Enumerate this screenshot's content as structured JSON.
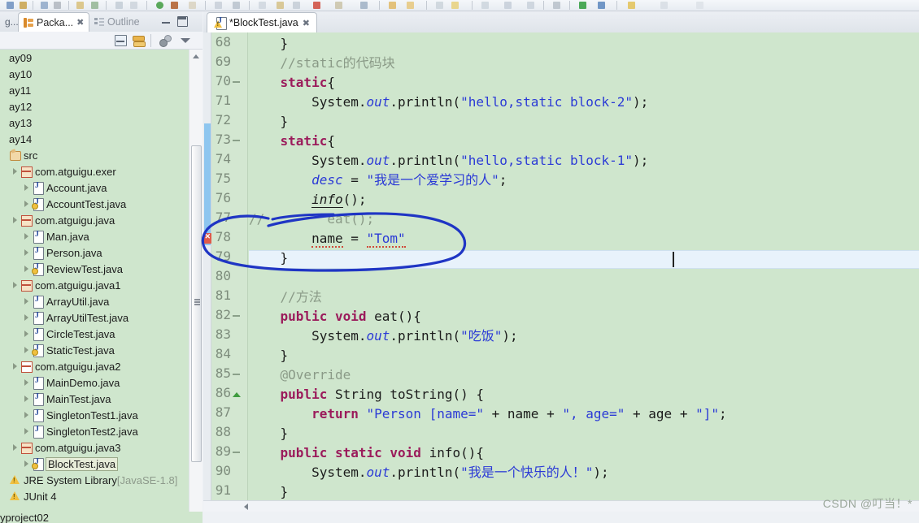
{
  "toolbar": {
    "name": "eclipse-toolbar"
  },
  "left_panel": {
    "tabs": {
      "partial_label": "g...",
      "active_label": "Packa...",
      "inactive_label": "Outline",
      "close_glyph": "✖"
    },
    "view_buttons": {
      "minimize": "minimize",
      "maximize": "maximize",
      "collapse_all": "collapse-all",
      "link_with_editor": "link-with-editor",
      "view_menu": "view-menu"
    },
    "tree": [
      {
        "label": "ay09",
        "indent": 0,
        "icon": "none",
        "arrow": "none",
        "selected": false
      },
      {
        "label": "ay10",
        "indent": 0,
        "icon": "none",
        "arrow": "none",
        "selected": false
      },
      {
        "label": "ay11",
        "indent": 0,
        "icon": "none",
        "arrow": "none",
        "selected": false
      },
      {
        "label": "ay12",
        "indent": 0,
        "icon": "none",
        "arrow": "none",
        "selected": false
      },
      {
        "label": "ay13",
        "indent": 0,
        "icon": "none",
        "arrow": "none",
        "selected": false
      },
      {
        "label": "ay14",
        "indent": 0,
        "icon": "none",
        "arrow": "none",
        "selected": false
      },
      {
        "label": "src",
        "indent": 0,
        "icon": "source-folder",
        "arrow": "none",
        "selected": false
      },
      {
        "label": "com.atguigu.exer",
        "indent": 1,
        "icon": "package-shaded",
        "arrow": "open",
        "selected": false
      },
      {
        "label": "Account.java",
        "indent": 2,
        "icon": "java-file",
        "arrow": "closed",
        "selected": false
      },
      {
        "label": "AccountTest.java",
        "indent": 2,
        "icon": "java-file-warn",
        "arrow": "closed",
        "selected": false
      },
      {
        "label": "com.atguigu.java",
        "indent": 1,
        "icon": "package-shaded",
        "arrow": "open",
        "selected": false
      },
      {
        "label": "Man.java",
        "indent": 2,
        "icon": "java-file",
        "arrow": "closed",
        "selected": false
      },
      {
        "label": "Person.java",
        "indent": 2,
        "icon": "java-file",
        "arrow": "closed",
        "selected": false
      },
      {
        "label": "ReviewTest.java",
        "indent": 2,
        "icon": "java-file-warn",
        "arrow": "closed",
        "selected": false
      },
      {
        "label": "com.atguigu.java1",
        "indent": 1,
        "icon": "package-shaded",
        "arrow": "open",
        "selected": false
      },
      {
        "label": "ArrayUtil.java",
        "indent": 2,
        "icon": "java-file",
        "arrow": "closed",
        "selected": false
      },
      {
        "label": "ArrayUtilTest.java",
        "indent": 2,
        "icon": "java-file",
        "arrow": "closed",
        "selected": false
      },
      {
        "label": "CircleTest.java",
        "indent": 2,
        "icon": "java-file",
        "arrow": "closed",
        "selected": false
      },
      {
        "label": "StaticTest.java",
        "indent": 2,
        "icon": "java-file-warn",
        "arrow": "closed",
        "selected": false
      },
      {
        "label": "com.atguigu.java2",
        "indent": 1,
        "icon": "package",
        "arrow": "open",
        "selected": false
      },
      {
        "label": "MainDemo.java",
        "indent": 2,
        "icon": "java-file",
        "arrow": "closed",
        "selected": false
      },
      {
        "label": "MainTest.java",
        "indent": 2,
        "icon": "java-file",
        "arrow": "closed",
        "selected": false
      },
      {
        "label": "SingletonTest1.java",
        "indent": 2,
        "icon": "java-file",
        "arrow": "closed",
        "selected": false
      },
      {
        "label": "SingletonTest2.java",
        "indent": 2,
        "icon": "java-file",
        "arrow": "closed",
        "selected": false
      },
      {
        "label": "com.atguigu.java3",
        "indent": 1,
        "icon": "package-shaded",
        "arrow": "open",
        "selected": false
      },
      {
        "label": "BlockTest.java",
        "indent": 2,
        "icon": "java-file-warn",
        "arrow": "closed",
        "selected": true
      },
      {
        "label": "JRE System Library",
        "suffix": "[JavaSE-1.8]",
        "indent": 0,
        "icon": "library",
        "arrow": "none",
        "selected": false
      },
      {
        "label": "JUnit 4",
        "indent": 0,
        "icon": "library",
        "arrow": "none",
        "selected": false
      }
    ],
    "bottom_partial_label": "yproject02"
  },
  "editor": {
    "tab_label": "*BlockTest.java",
    "tab_close_glyph": "✖",
    "first_visible_line": 68,
    "cursor_line": 78,
    "error_line": 78,
    "error_marker": "error-x",
    "lines": [
      {
        "n": 68,
        "fold": "",
        "html": "    }"
      },
      {
        "n": 69,
        "fold": "",
        "html": "    <span class=\"cmt\">//static的代码块</span>"
      },
      {
        "n": 70,
        "fold": "minus",
        "html": "    <span class=\"kw\">static</span>{"
      },
      {
        "n": 71,
        "fold": "",
        "html": "        System.<span class=\"fld\">out</span>.println(<span class=\"str\">\"hello,static block-2\"</span>);"
      },
      {
        "n": 72,
        "fold": "",
        "html": "    }"
      },
      {
        "n": 73,
        "fold": "minus",
        "html": "    <span class=\"kw\">static</span>{"
      },
      {
        "n": 74,
        "fold": "",
        "html": "        System.<span class=\"fld\">out</span>.println(<span class=\"str\">\"hello,static block-1\"</span>);"
      },
      {
        "n": 75,
        "fold": "",
        "html": "        <span class=\"fld\">desc</span> = <span class=\"str\">\"我是一个爱学习的人\"</span>;"
      },
      {
        "n": 76,
        "fold": "",
        "html": "        <span class=\"mth-i\">info</span>();"
      },
      {
        "n": 77,
        "fold": "",
        "html": "<span class=\"cmt\">//</span>        <span class=\"cmt\">eat</span><span class=\"cmt\">();</span>"
      },
      {
        "n": 78,
        "fold": "",
        "html": "        <span class=\"fld-u sq\">name</span> = <span class=\"str sq\">\"Tom\"</span>"
      },
      {
        "n": 79,
        "fold": "",
        "html": "    }"
      },
      {
        "n": 80,
        "fold": "",
        "html": ""
      },
      {
        "n": 81,
        "fold": "",
        "html": "    <span class=\"cmt\">//方法</span>"
      },
      {
        "n": 82,
        "fold": "minus",
        "html": "    <span class=\"kw\">public</span> <span class=\"kw\">void</span> eat(){"
      },
      {
        "n": 83,
        "fold": "",
        "html": "        System.<span class=\"fld\">out</span>.println(<span class=\"str\">\"吃饭\"</span>);"
      },
      {
        "n": 84,
        "fold": "",
        "html": "    }"
      },
      {
        "n": 85,
        "fold": "minus",
        "html": "    <span class=\"anno\">@Override</span>"
      },
      {
        "n": 86,
        "fold": "up",
        "html": "    <span class=\"kw\">public</span> String toString() {"
      },
      {
        "n": 87,
        "fold": "",
        "html": "        <span class=\"kw\">return</span> <span class=\"str\">\"Person [name=\"</span> + name + <span class=\"str\">\", age=\"</span> + age + <span class=\"str\">\"]\"</span>;"
      },
      {
        "n": 88,
        "fold": "",
        "html": "    }"
      },
      {
        "n": 89,
        "fold": "minus",
        "html": "    <span class=\"kw\">public</span> <span class=\"kw\">static</span> <span class=\"kw\">void</span> info(){"
      },
      {
        "n": 90,
        "fold": "",
        "html": "        System.<span class=\"fld\">out</span>.println(<span class=\"str\">\"我是一个快乐的人！\"</span>);"
      },
      {
        "n": 91,
        "fold": "",
        "html": "    }"
      }
    ]
  },
  "annotation": {
    "type": "hand-drawn-ellipse",
    "color": "#1f35c4",
    "covers_lines": [
      77,
      78,
      79
    ]
  },
  "watermark": "CSDN @叮当！*",
  "colors": {
    "editor_background": "#cfe6cd",
    "tree_background": "#cfe6cd",
    "keyword": "#9b1b5b",
    "string": "#2b3ad6",
    "comment": "#8a9a87",
    "error": "#e05a4a",
    "change_bar": "#8ec6ef",
    "ink": "#1f35c4"
  }
}
